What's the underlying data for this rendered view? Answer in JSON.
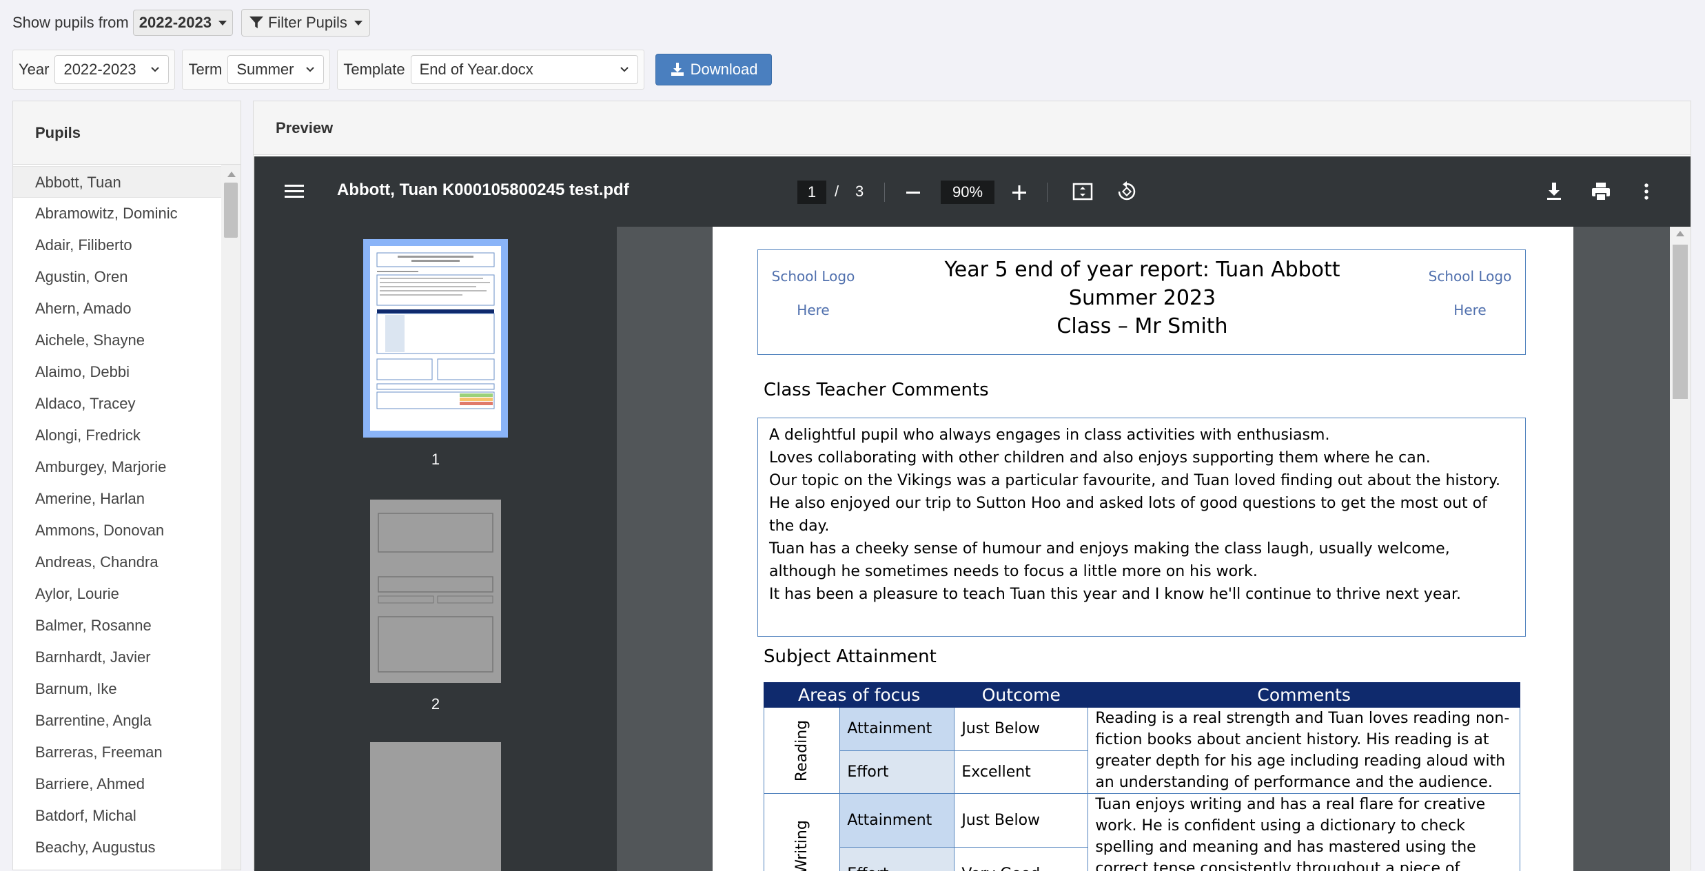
{
  "filters": {
    "show_label": "Show pupils from",
    "show_value": "2022-2023",
    "filter_button": "Filter Pupils",
    "year_label": "Year",
    "year_value": "2022-2023",
    "term_label": "Term",
    "term_value": "Summer",
    "template_label": "Template",
    "template_value": "End of Year.docx",
    "download_label": "Download"
  },
  "pupils": {
    "title": "Pupils",
    "items": [
      "Abbott, Tuan",
      "Abramowitz, Dominic",
      "Adair, Filiberto",
      "Agustin, Oren",
      "Ahern, Amado",
      "Aichele, Shayne",
      "Alaimo, Debbi",
      "Aldaco, Tracey",
      "Alongi, Fredrick",
      "Amburgey, Marjorie",
      "Amerine, Harlan",
      "Ammons, Donovan",
      "Andreas, Chandra",
      "Aylor, Lourie",
      "Balmer, Rosanne",
      "Barnhardt, Javier",
      "Barnum, Ike",
      "Barrentine, Angla",
      "Barreras, Freeman",
      "Barriere, Ahmed",
      "Batdorf, Michal",
      "Beachy, Augustus"
    ]
  },
  "preview": {
    "title": "Preview",
    "viewer": {
      "doc_title": "Abbott, Tuan K000105800245 test.pdf",
      "page_current": "1",
      "page_sep": "/",
      "page_total": "3",
      "zoom": "90%",
      "thumb_labels": [
        "1",
        "2"
      ]
    },
    "report": {
      "logo_left": [
        "School Logo",
        "Here"
      ],
      "logo_right": [
        "School Logo",
        "Here"
      ],
      "title_lines": [
        "Year 5 end of year report: Tuan  Abbott",
        "Summer 2023",
        "Class – Mr Smith"
      ],
      "comments_heading": "Class Teacher Comments",
      "comments": [
        "A delightful pupil who always engages in class activities with enthusiasm.",
        "Loves collaborating with other children and also enjoys supporting them where he can.",
        "Our topic on the Vikings was a particular favourite, and Tuan loved finding out about the history. He also enjoyed our trip to Sutton Hoo and asked lots of good questions to get the most out of the day.",
        "Tuan has a cheeky sense of humour and enjoys making the class laugh, usually welcome, although he sometimes needs to focus a little more on his work.",
        "It has been a pleasure to teach Tuan this year and I know he'll continue to thrive next year."
      ],
      "attainment_heading": "Subject Attainment",
      "table_headers": [
        "Areas of focus",
        "Outcome",
        "Comments"
      ],
      "subjects": [
        {
          "area": "Reading",
          "rows": [
            {
              "criterion": "Attainment",
              "outcome": "Just Below"
            },
            {
              "criterion": "Effort",
              "outcome": "Excellent"
            }
          ],
          "comment": "Reading is a real strength and Tuan loves reading non-fiction books about ancient history. His reading is at greater depth for his age including reading aloud with an understanding of performance and the audience."
        },
        {
          "area": "Writing",
          "rows": [
            {
              "criterion": "Attainment",
              "outcome": "Just Below"
            },
            {
              "criterion": "Effort",
              "outcome": "Very Good"
            }
          ],
          "comment": "Tuan enjoys writing and has a real flare for creative work. He is confident using a dictionary to check spelling and meaning and has mastered using the correct tense consistently throughout a piece of writing."
        }
      ]
    }
  }
}
